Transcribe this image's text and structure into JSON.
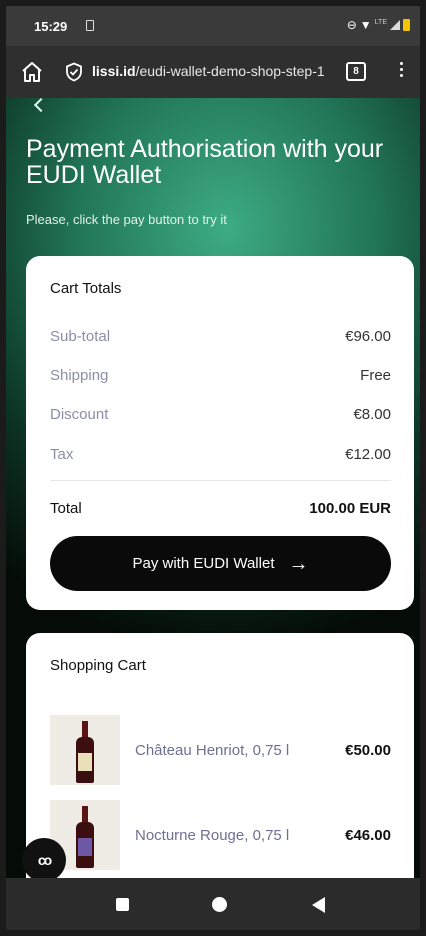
{
  "status_bar": {
    "time": "15:29",
    "network": "LTE"
  },
  "browser": {
    "url_host": "lissi.id",
    "url_path": "/eudi-wallet-demo-shop-step-1",
    "tab_count": "8"
  },
  "page": {
    "title": "Payment Authorisation with your EUDI Wallet",
    "subtitle": "Please, click the pay button to try it"
  },
  "cart_totals": {
    "title": "Cart Totals",
    "rows": [
      {
        "label": "Sub-total",
        "value": "€96.00"
      },
      {
        "label": "Shipping",
        "value": "Free"
      },
      {
        "label": "Discount",
        "value": "€8.00"
      },
      {
        "label": "Tax",
        "value": "€12.00"
      }
    ],
    "total_label": "Total",
    "total_value": "100.00 EUR",
    "pay_button": "Pay with EUDI Wallet",
    "pay_arrow": "→"
  },
  "shopping_cart": {
    "title": "Shopping Cart",
    "items": [
      {
        "name": "Château Henriot, 0,75 l",
        "price": "€50.00"
      },
      {
        "name": "Nocturne Rouge, 0,75 l",
        "price": "€46.00"
      }
    ]
  },
  "fab_label": "co",
  "colors": {
    "accent_green": "#2e9b73",
    "button_black": "#0a0a0a",
    "muted_label": "#8c8ea6"
  }
}
